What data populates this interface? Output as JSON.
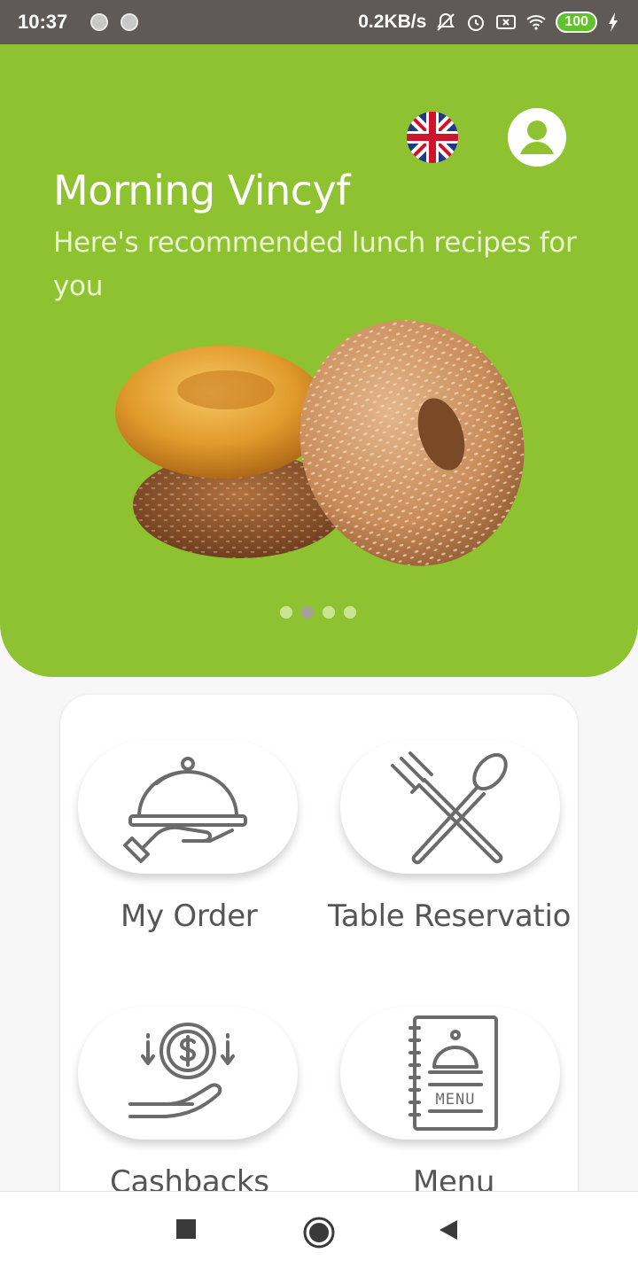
{
  "status_bar": {
    "time": "10:37",
    "net_speed": "0.2KB/s",
    "battery": "100"
  },
  "hero": {
    "greeting": "Morning Vincyf",
    "subtitle": "Here's recommended lunch recipes for you",
    "carousel_dots": 4,
    "active_dot": 2,
    "language": "en-GB"
  },
  "menu": {
    "items": [
      {
        "label": "My Order",
        "icon": "cloche-hand-icon"
      },
      {
        "label": "Table Reservatio",
        "icon": "fork-spoon-icon"
      },
      {
        "label": "Cashbacks",
        "icon": "cashback-icon"
      },
      {
        "label": "Menu",
        "icon": "menu-book-icon"
      }
    ]
  },
  "colors": {
    "brand_green": "#8fc230",
    "icon_gray": "#6b6b6b"
  }
}
